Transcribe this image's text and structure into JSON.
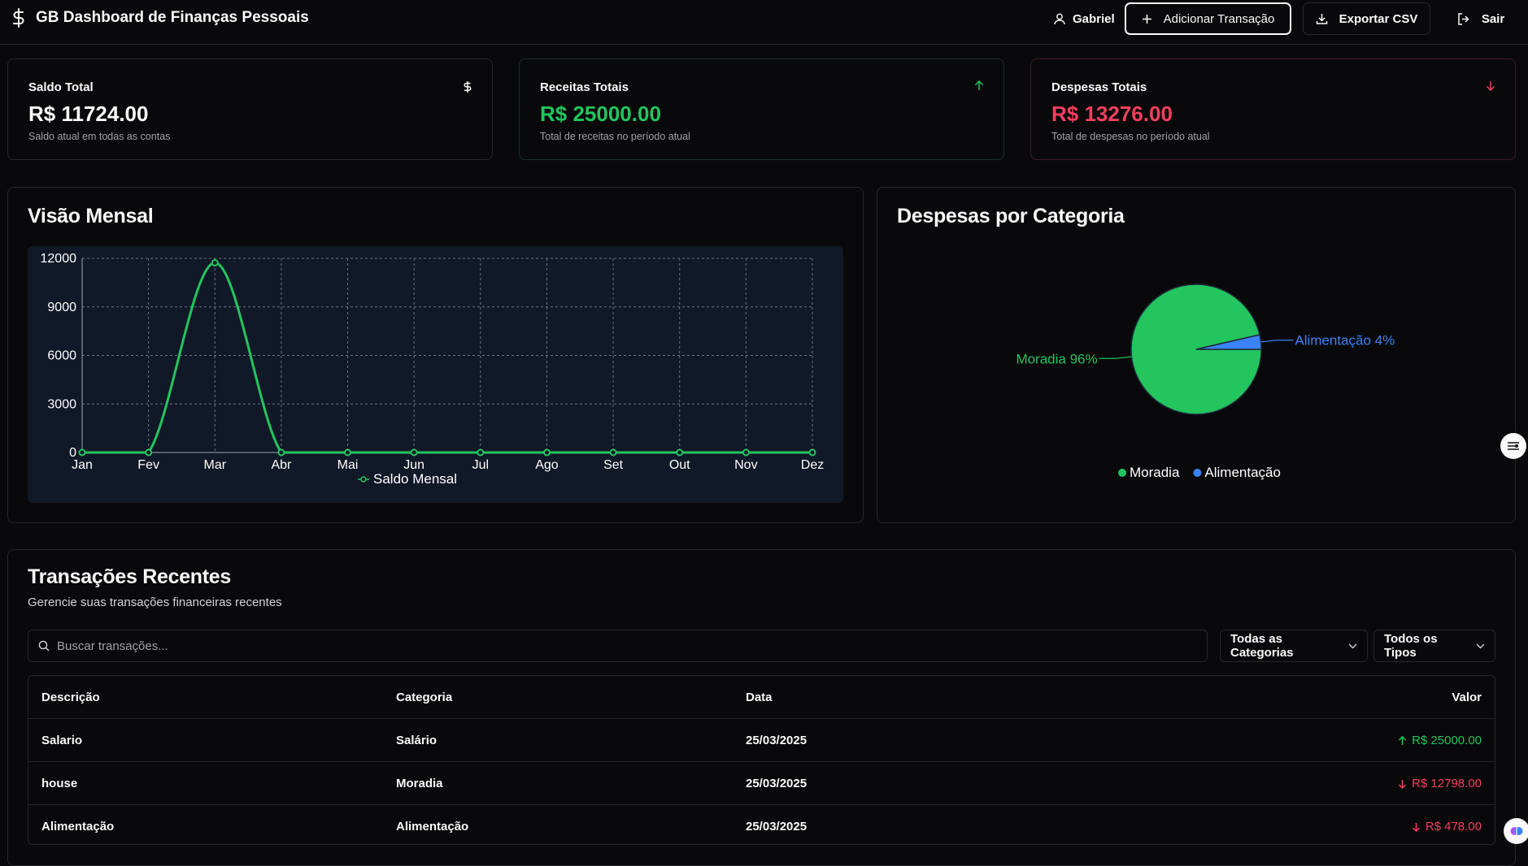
{
  "header": {
    "title": "GB Dashboard de Finanças Pessoais",
    "user": "Gabriel",
    "add_label": "Adicionar Transação",
    "export_label": "Exportar CSV",
    "exit_label": "Sair"
  },
  "stats": [
    {
      "title": "Saldo Total",
      "value": "R$ 11724.00",
      "sub": "Saldo atual em todas as contas",
      "icon": "dollar-icon"
    },
    {
      "title": "Receitas Totais",
      "value": "R$ 25000.00",
      "sub": "Total de receitas no período atual",
      "icon": "arrow-up-icon",
      "color": "#22c55e"
    },
    {
      "title": "Despesas Totais",
      "value": "R$ 13276.00",
      "sub": "Total de despesas no período atual",
      "icon": "arrow-down-icon",
      "color": "#f43f5e"
    }
  ],
  "monthly": {
    "title": "Visão Mensal"
  },
  "categories": {
    "title": "Despesas por Categoria"
  },
  "chart_data": [
    {
      "type": "line",
      "x": [
        "Jan",
        "Fev",
        "Mar",
        "Abr",
        "Mai",
        "Jun",
        "Jul",
        "Ago",
        "Set",
        "Out",
        "Nov",
        "Dez"
      ],
      "series": [
        {
          "name": "Saldo Mensal",
          "values": [
            0,
            0,
            11724,
            0,
            0,
            0,
            0,
            0,
            0,
            0,
            0,
            0
          ],
          "color": "#22c55e"
        }
      ],
      "ylim": [
        0,
        12000
      ],
      "yticks": [
        0,
        3000,
        6000,
        9000,
        12000
      ],
      "grid": true,
      "legend": "bottom-center"
    },
    {
      "type": "pie",
      "slices": [
        {
          "label": "Moradia",
          "value": 12798,
          "percent_label": "Moradia 96%",
          "color": "#22c55e"
        },
        {
          "label": "Alimentação",
          "value": 478,
          "percent_label": "Alimentação 4%",
          "color": "#3b82f6"
        }
      ],
      "legend": "bottom-center"
    }
  ],
  "transactions": {
    "title": "Transações Recentes",
    "subtitle": "Gerencie suas transações financeiras recentes",
    "search_placeholder": "Buscar transações...",
    "category_filter": "Todas as Categorias",
    "type_filter": "Todos os Tipos",
    "columns": [
      "Descrição",
      "Categoria",
      "Data",
      "Valor"
    ],
    "rows": [
      {
        "desc": "Salario",
        "category": "Salário",
        "date": "25/03/2025",
        "value": "R$ 25000.00",
        "type": "income"
      },
      {
        "desc": "house",
        "category": "Moradia",
        "date": "25/03/2025",
        "value": "R$ 12798.00",
        "type": "expense"
      },
      {
        "desc": "Alimentação",
        "category": "Alimentação",
        "date": "25/03/2025",
        "value": "R$ 478.00",
        "type": "expense"
      }
    ]
  }
}
